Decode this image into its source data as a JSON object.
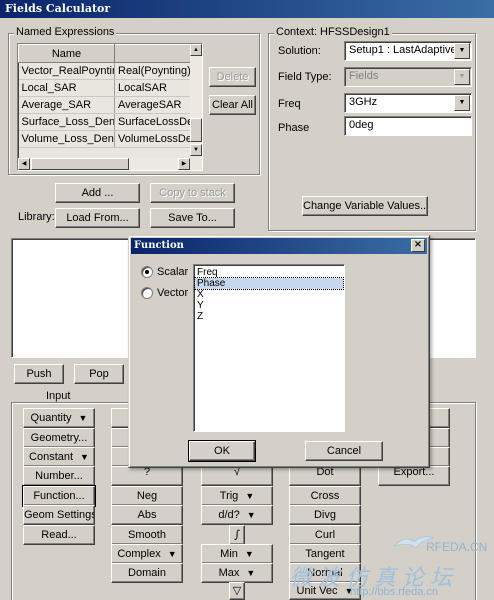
{
  "window": {
    "title": "Fields Calculator"
  },
  "named_expressions": {
    "group_title": "Named Expressions",
    "columns": [
      "Name",
      ""
    ],
    "rows": [
      [
        "Vector_RealPoynting",
        "Real(Poynting)"
      ],
      [
        "Local_SAR",
        "LocalSAR"
      ],
      [
        "Average_SAR",
        "AverageSAR"
      ],
      [
        "Surface_Loss_Density",
        "SurfaceLossDens"
      ],
      [
        "Volume_Loss_Density",
        "VolumeLossDens"
      ]
    ],
    "delete_label": "Delete",
    "clear_all_label": "Clear All",
    "add_label": "Add ...",
    "copy_to_stack_label": "Copy to stack",
    "library_label": "Library:",
    "load_from_label": "Load From...",
    "save_to_label": "Save To..."
  },
  "context": {
    "group_title": "Context: HFSSDesign1",
    "solution_label": "Solution:",
    "solution_value": "Setup1 : LastAdaptive",
    "field_type_label": "Field Type:",
    "field_type_value": "Fields",
    "freq_label": "Freq",
    "freq_value": "3GHz",
    "phase_label": "Phase",
    "phase_value": "0deg",
    "change_label": "Change Variable Values..."
  },
  "stack": {
    "push_label": "Push",
    "pop_label": "Pop",
    "input_label": "Input"
  },
  "calc_buttons": {
    "col1": [
      "Quantity",
      "Geometry...",
      "Constant",
      "Number...",
      "Function...",
      "Geom Settings...",
      "Read..."
    ],
    "col2": [
      "Neg",
      "Abs",
      "Smooth",
      "Complex",
      "Domain"
    ],
    "col3": [
      "Trig",
      "d/d?",
      "∫",
      "Min",
      "Max",
      "▽"
    ],
    "col4": [
      "Dot",
      "Cross",
      "Divg",
      "Curl",
      "Tangent",
      "Normal",
      "Unit Vec"
    ],
    "col2_partial": "?",
    "col3_partial": "√",
    "col5_partial": "Export..."
  },
  "function_dialog": {
    "title": "Function",
    "close_glyph": "×",
    "scalar_label": "Scalar",
    "vector_label": "Vector",
    "options": [
      "Freq",
      "Phase",
      "X",
      "Y",
      "Z"
    ],
    "selected_option": "Phase",
    "ok_label": "OK",
    "cancel_label": "Cancel"
  },
  "watermark": {
    "cn_text": "微波仿真论坛",
    "site": "RFEDA.CN",
    "url": "http://bbs.rfeda.cn"
  },
  "colors": {
    "title_start": "#0a246a",
    "title_end": "#3a6ea5",
    "face": "#d4d0c8"
  },
  "icons": {
    "dropdown": "down-triangle",
    "menu_button_arrow": "down-arrow-bar"
  }
}
